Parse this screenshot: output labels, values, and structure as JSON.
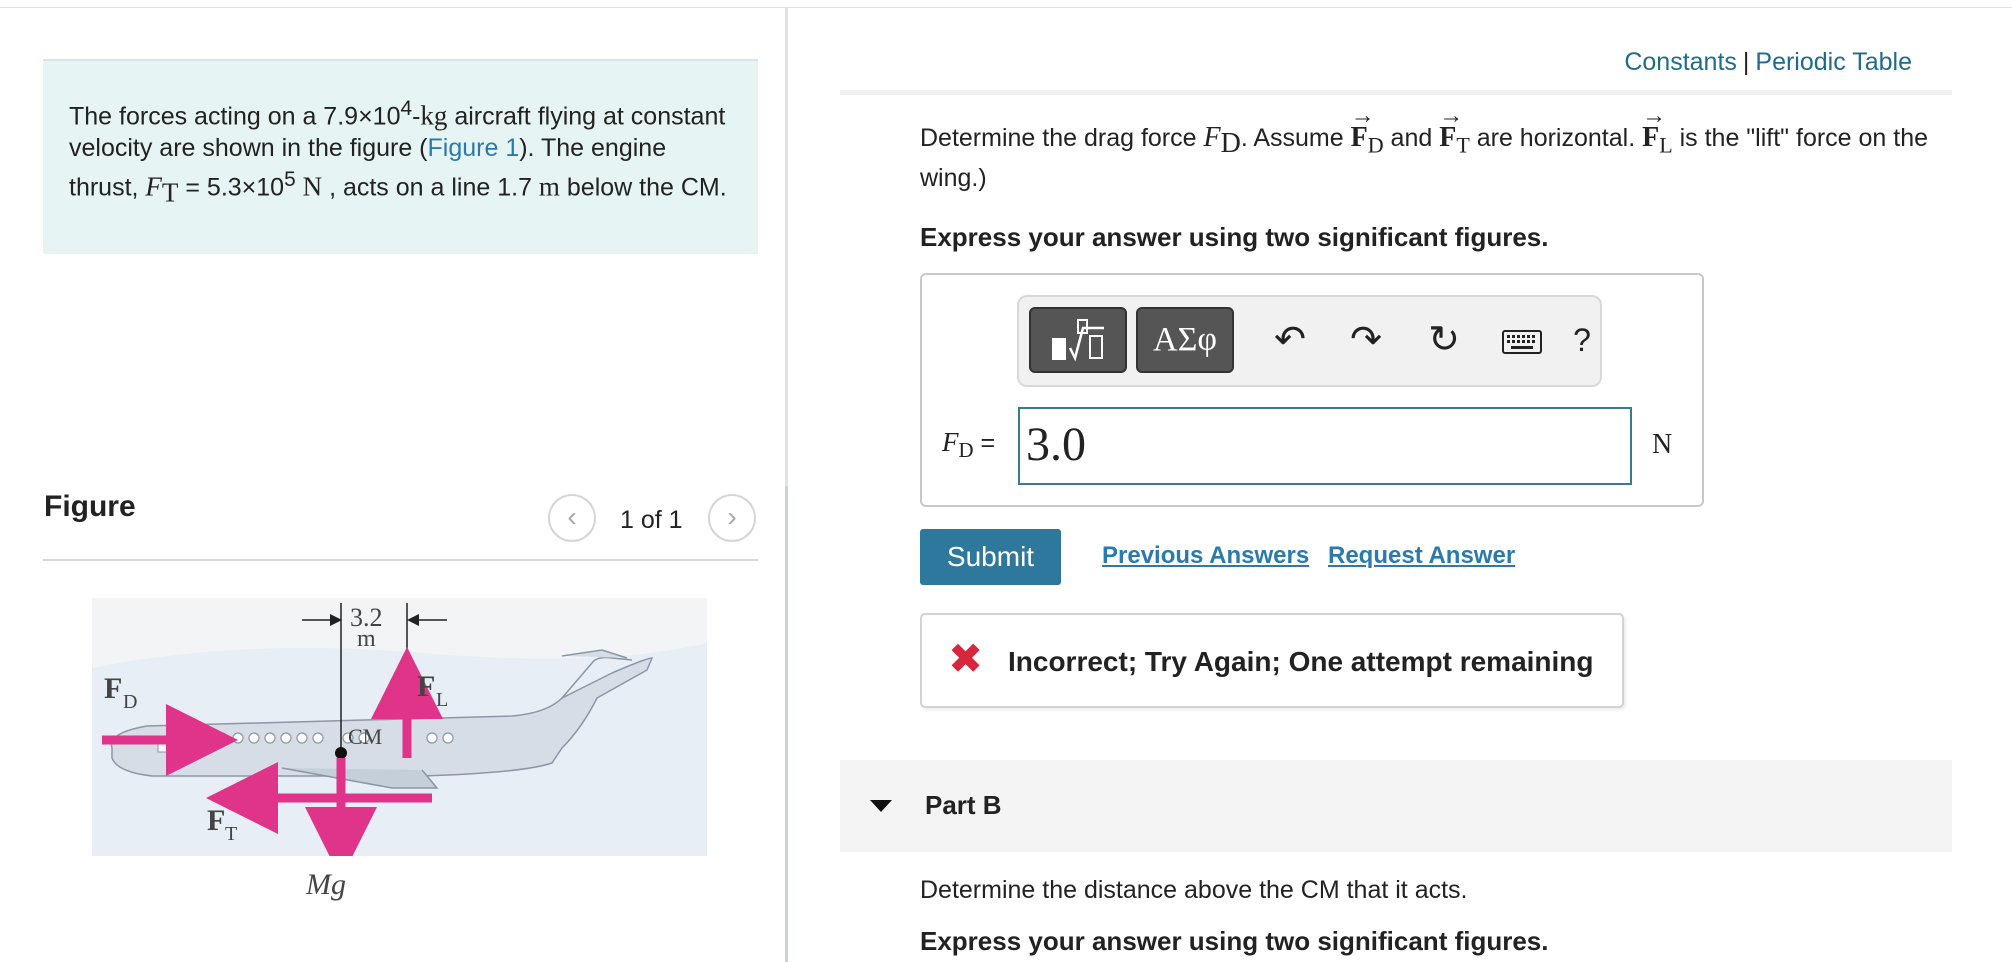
{
  "problem": {
    "t1": "The forces acting on a 7.9×10",
    "mass_exp": "4",
    "t2": "-",
    "mass_unit": "kg",
    "t3": " aircraft flying at constant velocity are shown in the figure (",
    "figure_link": "Figure 1",
    "t4": "). The engine thrust, ",
    "thrust_symbol": "F",
    "thrust_sub": "T",
    "t5": " = 5.3×10",
    "thrust_exp": "5",
    "newton_unit": "N",
    "t6": " , acts on a line 1.7 ",
    "meter_unit": "m",
    "t7": " below the CM."
  },
  "figure": {
    "title": "Figure",
    "pager": "1 of 1",
    "prev_icon": "chevron-left-icon",
    "next_icon": "chevron-right-icon",
    "dim_value": "3.2",
    "dim_unit": "m",
    "fd_label": "F",
    "fd_sub": "D",
    "fl_label": "F",
    "fl_sub": "L",
    "ft_label": "F",
    "ft_sub": "T",
    "cm_label": "CM",
    "mg_label": "Mg",
    "arrow_color": "#e0338a"
  },
  "header": {
    "constants": "Constants",
    "separator": "|",
    "periodic_table": "Periodic Table"
  },
  "question": {
    "q1": "Determine the drag force ",
    "fd": "F",
    "fd_sub": "D",
    "q2": ". Assume ",
    "vec_fd": "F",
    "vec_fd_sub": "D",
    "q3": " and ",
    "vec_ft": "F",
    "vec_ft_sub": "T",
    "q4": " are horizontal. ",
    "vec_fl": "F",
    "vec_fl_sub": "L",
    "q5": " is the \"lift\" force on the wing.)",
    "express": "Express your answer using two significant figures."
  },
  "toolbar": {
    "templates_icon": "templates-icon",
    "greek": "ΑΣφ",
    "undo_icon": "undo-icon",
    "redo_icon": "redo-icon",
    "reset_icon": "reset-icon",
    "keyboard_icon": "keyboard-icon",
    "help": "?"
  },
  "answer": {
    "label": "F",
    "label_sub": "D",
    "equals": " =",
    "value": "3.0",
    "unit": "N"
  },
  "actions": {
    "submit": "Submit",
    "previous_answers": "Previous Answers",
    "request_answer": "Request Answer"
  },
  "feedback": {
    "icon": "✖",
    "message": "Incorrect; Try Again; One attempt remaining",
    "color": "#d7263d"
  },
  "partB": {
    "label": "Part B",
    "question": "Determine the distance above the CM that it acts.",
    "express": "Express your answer using two significant figures."
  }
}
